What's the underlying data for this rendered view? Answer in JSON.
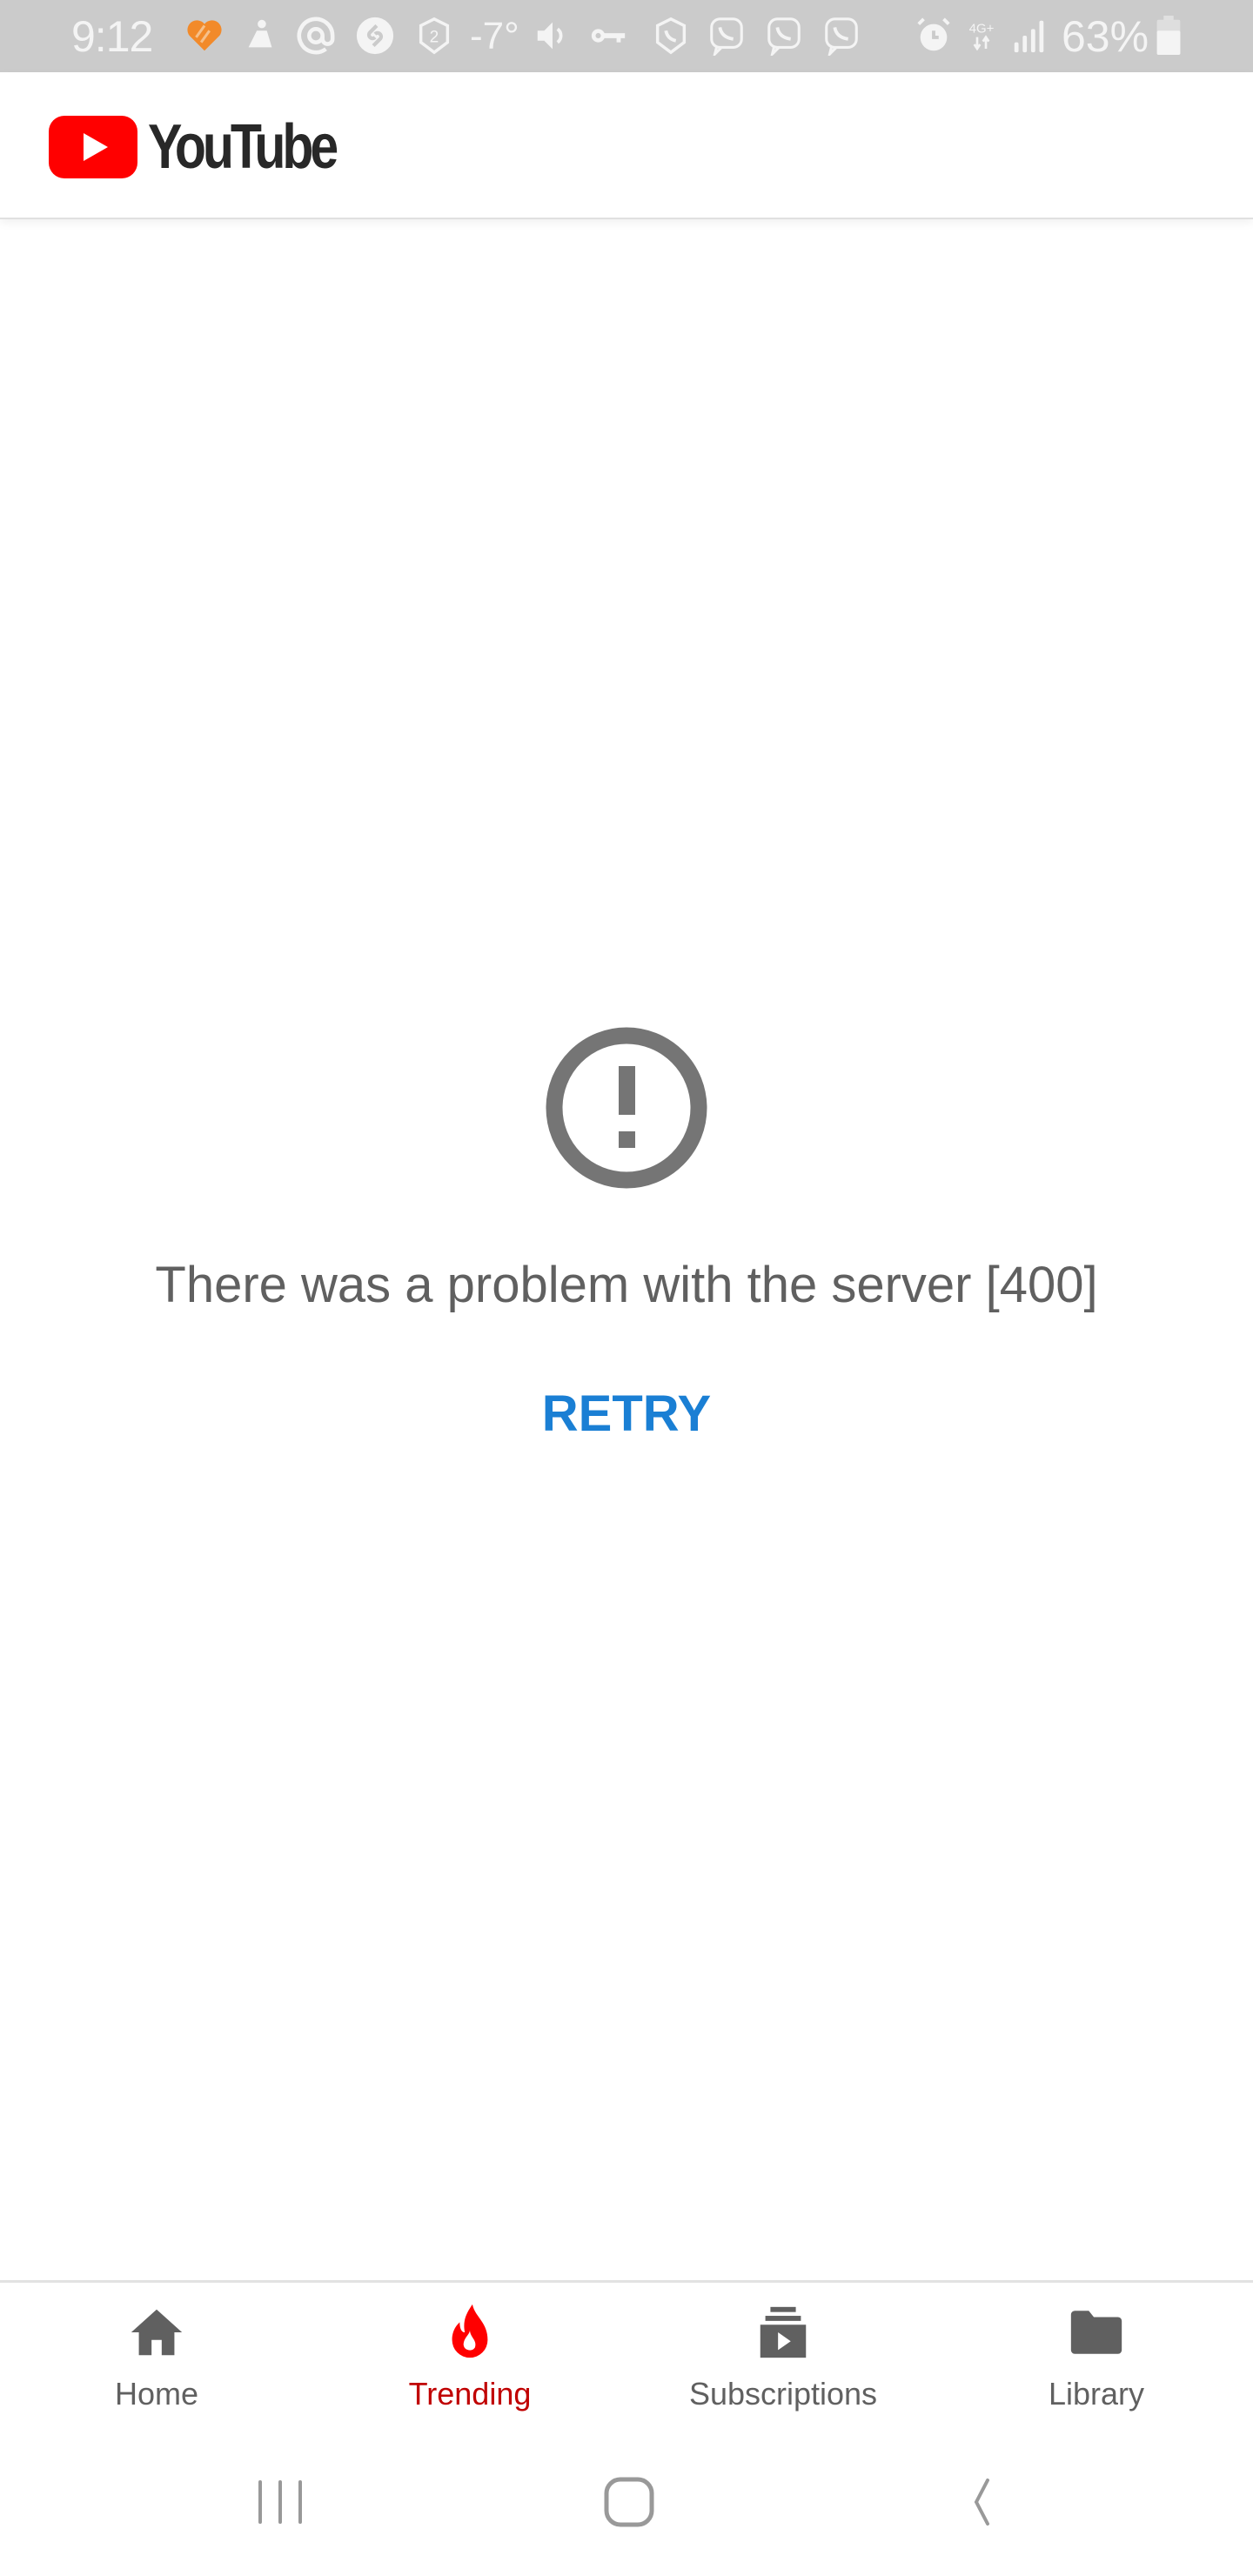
{
  "status_bar": {
    "time": "9:12",
    "temperature": "-7°",
    "network": "4G+",
    "battery_percent": "63%",
    "icons": [
      "health-heart-icon",
      "meditation-icon",
      "at-sign-icon",
      "shazam-icon",
      "shield-2-icon",
      "volume-icon",
      "vpn-key-icon",
      "shield-phone-icon",
      "viber-icon",
      "viber-icon",
      "viber-icon",
      "alarm-icon",
      "network-4g-icon",
      "signal-icon",
      "battery-icon"
    ],
    "colors": {
      "background": "#cbcbcb",
      "foreground": "#f4f4f4",
      "accent": "#f28a2a"
    }
  },
  "header": {
    "app_name": "YouTube",
    "brand_color": "#ff0000"
  },
  "error": {
    "icon": "error-circle-icon",
    "message": "There was a problem with the server [400]",
    "retry_label": "RETRY",
    "retry_color": "#1a7fd4"
  },
  "bottom_nav": {
    "items": [
      {
        "label": "Home",
        "icon": "home-icon",
        "active": false
      },
      {
        "label": "Trending",
        "icon": "flame-icon",
        "active": true
      },
      {
        "label": "Subscriptions",
        "icon": "subscriptions-icon",
        "active": false
      },
      {
        "label": "Library",
        "icon": "folder-icon",
        "active": false
      }
    ],
    "active_color": "#c00000",
    "inactive_color": "#606060"
  },
  "system_nav": {
    "buttons": [
      "recent-apps",
      "home",
      "back"
    ]
  }
}
